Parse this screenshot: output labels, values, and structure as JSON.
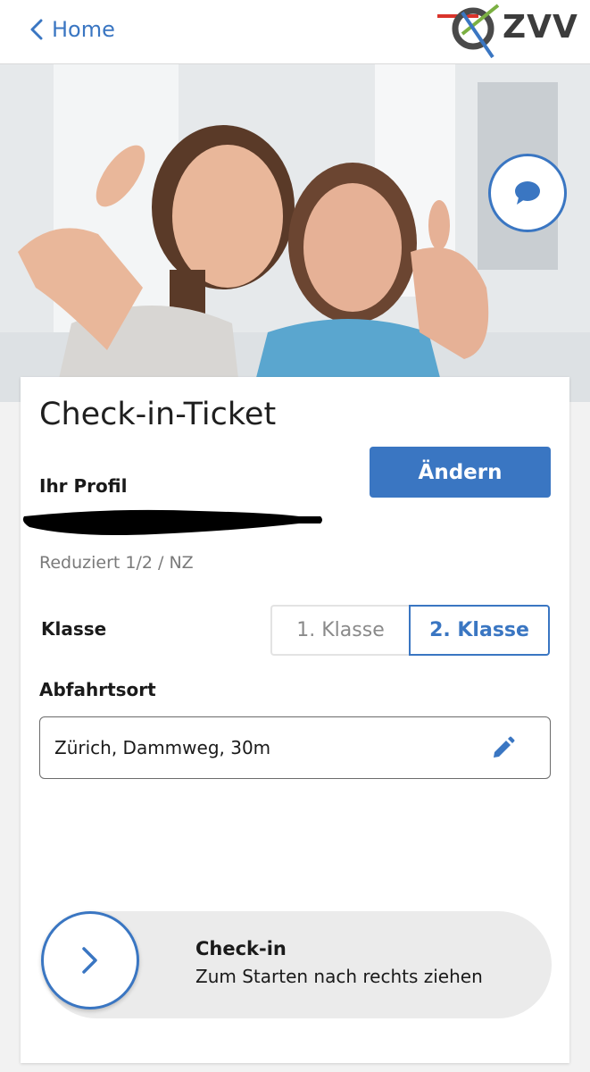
{
  "nav": {
    "back_label": "Home",
    "logo_text": "ZVV"
  },
  "hero": {
    "chat_icon": "chat-bubble-icon"
  },
  "ticket": {
    "title": "Check-in-Ticket",
    "profile_label": "Ihr Profil",
    "change_button": "Ändern",
    "profile_type": "Reduziert 1/2 / NZ",
    "class_label": "Klasse",
    "class_options": [
      "1. Klasse",
      "2. Klasse"
    ],
    "class_selected": "2. Klasse",
    "departure_label": "Abfahrtsort",
    "departure_value": "Zürich, Dammweg, 30m"
  },
  "slider": {
    "title": "Check-in",
    "subtitle": "Zum Starten nach rechts ziehen"
  },
  "colors": {
    "accent": "#3a76c2",
    "background": "#f2f2f2",
    "card": "#ffffff"
  }
}
